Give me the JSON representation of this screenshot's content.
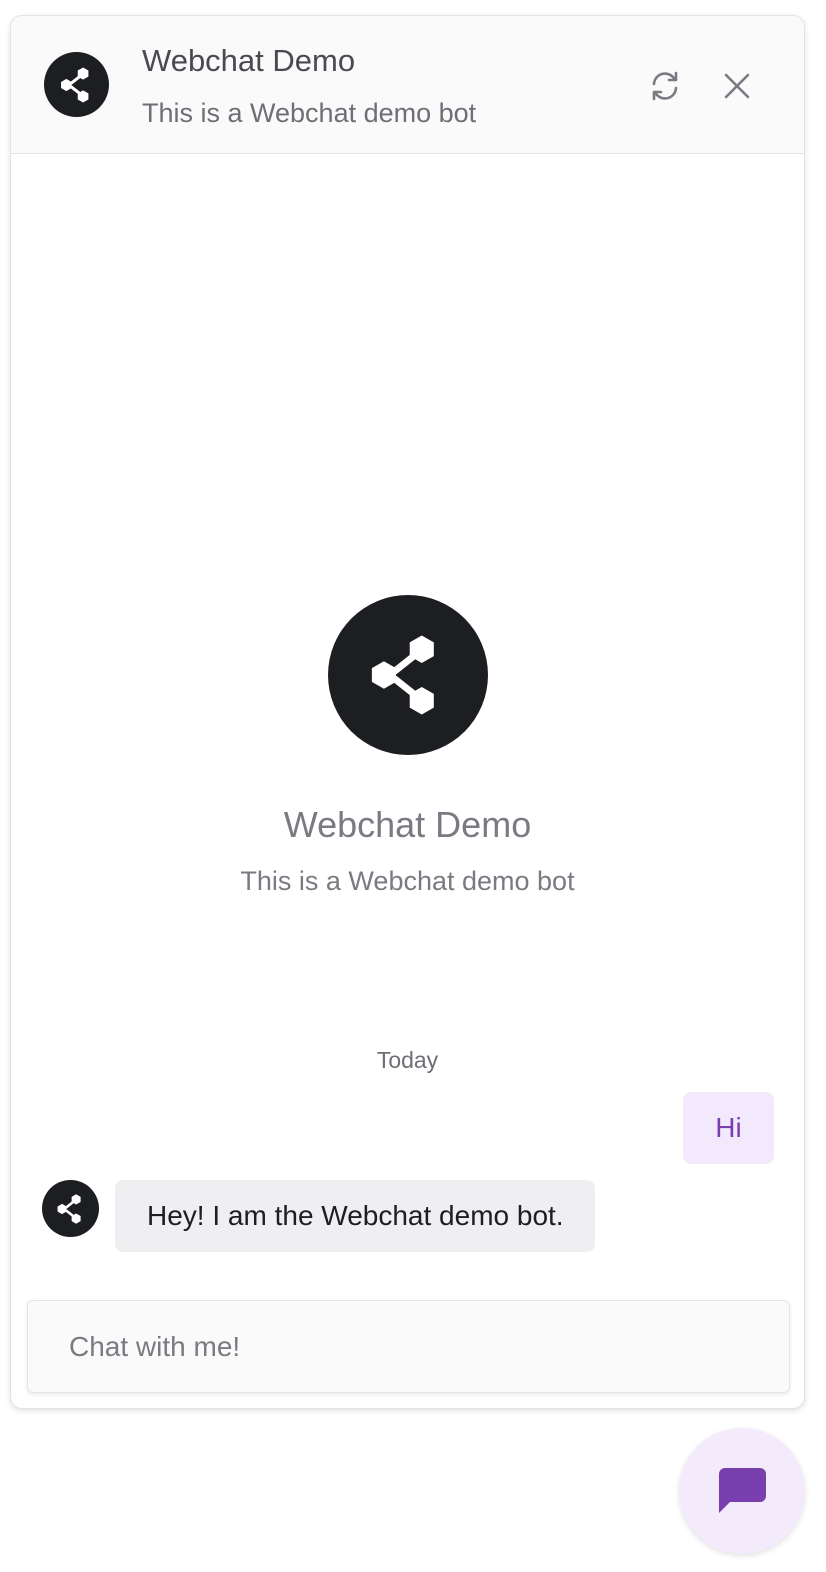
{
  "header": {
    "title": "Webchat Demo",
    "subtitle": "This is a Webchat demo bot",
    "avatar_icon": "share-nodes-icon",
    "refresh_icon": "refresh-icon",
    "close_icon": "close-icon"
  },
  "intro": {
    "title": "Webchat Demo",
    "subtitle": "This is a Webchat demo bot"
  },
  "conversation": {
    "date_label": "Today",
    "messages": [
      {
        "sender": "user",
        "text": "Hi"
      },
      {
        "sender": "bot",
        "text": "Hey! I am the Webchat demo bot."
      }
    ]
  },
  "composer": {
    "placeholder": "Chat with me!",
    "value": ""
  },
  "launcher": {
    "icon": "chat-bubble-icon"
  },
  "colors": {
    "accent": "#7a3fae",
    "accent_light": "#f2eafc",
    "avatar_bg": "#1c1e21",
    "bot_bubble_bg": "#efeff2"
  }
}
